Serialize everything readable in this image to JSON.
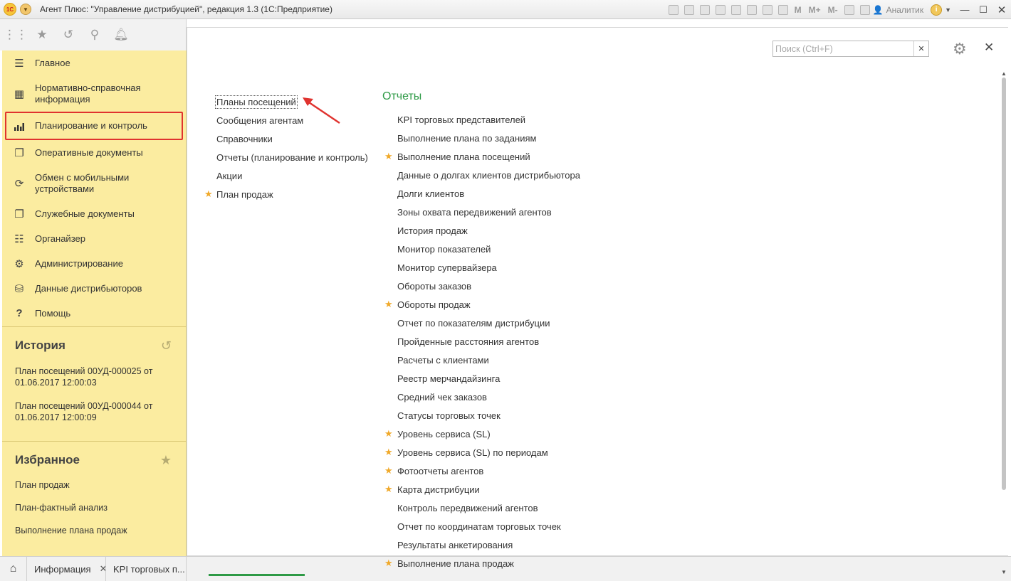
{
  "titlebar": {
    "logo": "1С",
    "title": "Агент Плюс: \"Управление дистрибуцией\", редакция 1.3  (1С:Предприятие)",
    "m_buttons": [
      "M",
      "M+",
      "M-"
    ],
    "user": "Аналитик"
  },
  "sidebar": {
    "items": [
      {
        "label": "Главное",
        "icon": "menu-lines-icon"
      },
      {
        "label": "Нормативно-справочная информация",
        "icon": "table-grid-icon"
      },
      {
        "label": "Планирование и контроль",
        "icon": "bar-chart-icon"
      },
      {
        "label": "Оперативные документы",
        "icon": "documents-icon"
      },
      {
        "label": "Обмен с мобильными устройствами",
        "icon": "sync-icon"
      },
      {
        "label": "Служебные документы",
        "icon": "documents-icon"
      },
      {
        "label": "Органайзер",
        "icon": "organizer-icon"
      },
      {
        "label": "Администрирование",
        "icon": "gear-icon"
      },
      {
        "label": "Данные дистрибьюторов",
        "icon": "distributor-icon"
      },
      {
        "label": "Помощь",
        "icon": "question-icon"
      }
    ],
    "active_index": 2,
    "history": {
      "title": "История",
      "items": [
        "План посещений 00УД-000025 от 01.06.2017 12:00:03",
        "План посещений 00УД-000044 от 01.06.2017 12:00:09"
      ]
    },
    "favorites": {
      "title": "Избранное",
      "items": [
        "План продаж",
        "План-фактный анализ",
        "Выполнение плана продаж"
      ]
    }
  },
  "tabs": {
    "items": [
      {
        "label": "Информация",
        "closable": true
      },
      {
        "label": "KPI торговых п..."
      }
    ]
  },
  "search": {
    "placeholder": "Поиск (Ctrl+F)",
    "value": ""
  },
  "links": [
    {
      "label": "Планы посещений",
      "starred": false,
      "focused": true
    },
    {
      "label": "Сообщения агентам",
      "starred": false
    },
    {
      "label": "Справочники",
      "starred": false
    },
    {
      "label": "Отчеты (планирование и контроль)",
      "starred": false
    },
    {
      "label": "Акции",
      "starred": false
    },
    {
      "label": "План продаж",
      "starred": true
    }
  ],
  "reports": {
    "title": "Отчеты",
    "items": [
      {
        "label": "KPI торговых представителей",
        "starred": false
      },
      {
        "label": "Выполнение плана по заданиям",
        "starred": false
      },
      {
        "label": "Выполнение плана посещений",
        "starred": true
      },
      {
        "label": "Данные о долгах клиентов дистрибьютора",
        "starred": false
      },
      {
        "label": "Долги клиентов",
        "starred": false
      },
      {
        "label": "Зоны охвата передвижений агентов",
        "starred": false
      },
      {
        "label": "История продаж",
        "starred": false
      },
      {
        "label": "Монитор показателей",
        "starred": false
      },
      {
        "label": "Монитор супервайзера",
        "starred": false
      },
      {
        "label": "Обороты заказов",
        "starred": false
      },
      {
        "label": "Обороты продаж",
        "starred": true
      },
      {
        "label": "Отчет по показателям дистрибуции",
        "starred": false
      },
      {
        "label": "Пройденные расстояния агентов",
        "starred": false
      },
      {
        "label": "Расчеты с клиентами",
        "starred": false
      },
      {
        "label": "Реестр мерчандайзинга",
        "starred": false
      },
      {
        "label": "Средний чек заказов",
        "starred": false
      },
      {
        "label": "Статусы торговых точек",
        "starred": false
      },
      {
        "label": "Уровень сервиса (SL)",
        "starred": true
      },
      {
        "label": "Уровень сервиса (SL) по периодам",
        "starred": true
      },
      {
        "label": "Фотоотчеты агентов",
        "starred": true
      },
      {
        "label": "Карта дистрибуции",
        "starred": true
      },
      {
        "label": "Контроль передвижений агентов",
        "starred": false
      },
      {
        "label": "Отчет по координатам торговых точек",
        "starred": false
      },
      {
        "label": "Результаты анкетирования",
        "starred": false
      },
      {
        "label": "Выполнение плана продаж",
        "starred": true
      }
    ]
  },
  "colors": {
    "sidebar_bg": "#fbeca0",
    "highlight_border": "#e0332f",
    "reports_title": "#2e9a46",
    "star": "#f0a92a"
  }
}
